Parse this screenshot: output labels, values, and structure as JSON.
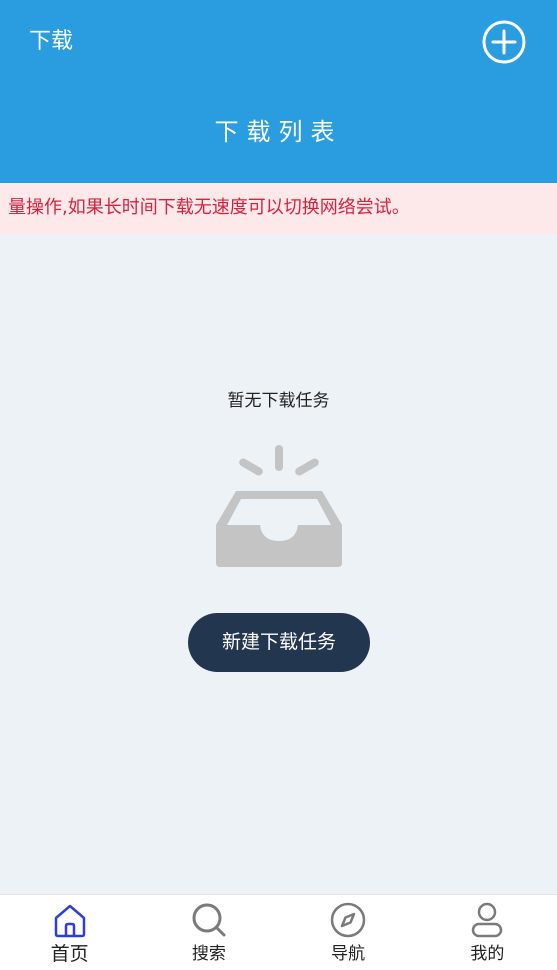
{
  "header": {
    "left_title": "下载",
    "page_title": "下载列表",
    "add_icon": "plus-circle-icon",
    "background_color": "#2a9de0"
  },
  "notice": {
    "text": "量操作,如果长时间下载无速度可以切换网络尝试。",
    "text_color": "#d5233f",
    "background_color": "#fde8ea"
  },
  "empty_state": {
    "text": "暂无下载任务",
    "icon": "empty-inbox-icon",
    "button_label": "新建下载任务",
    "button_color": "#233650"
  },
  "bottom_nav": {
    "active_index": 0,
    "active_color": "#2d3fd8",
    "items": [
      {
        "label": "首页",
        "icon": "home-icon"
      },
      {
        "label": "搜索",
        "icon": "search-icon"
      },
      {
        "label": "导航",
        "icon": "compass-icon"
      },
      {
        "label": "我的",
        "icon": "user-icon"
      }
    ]
  }
}
